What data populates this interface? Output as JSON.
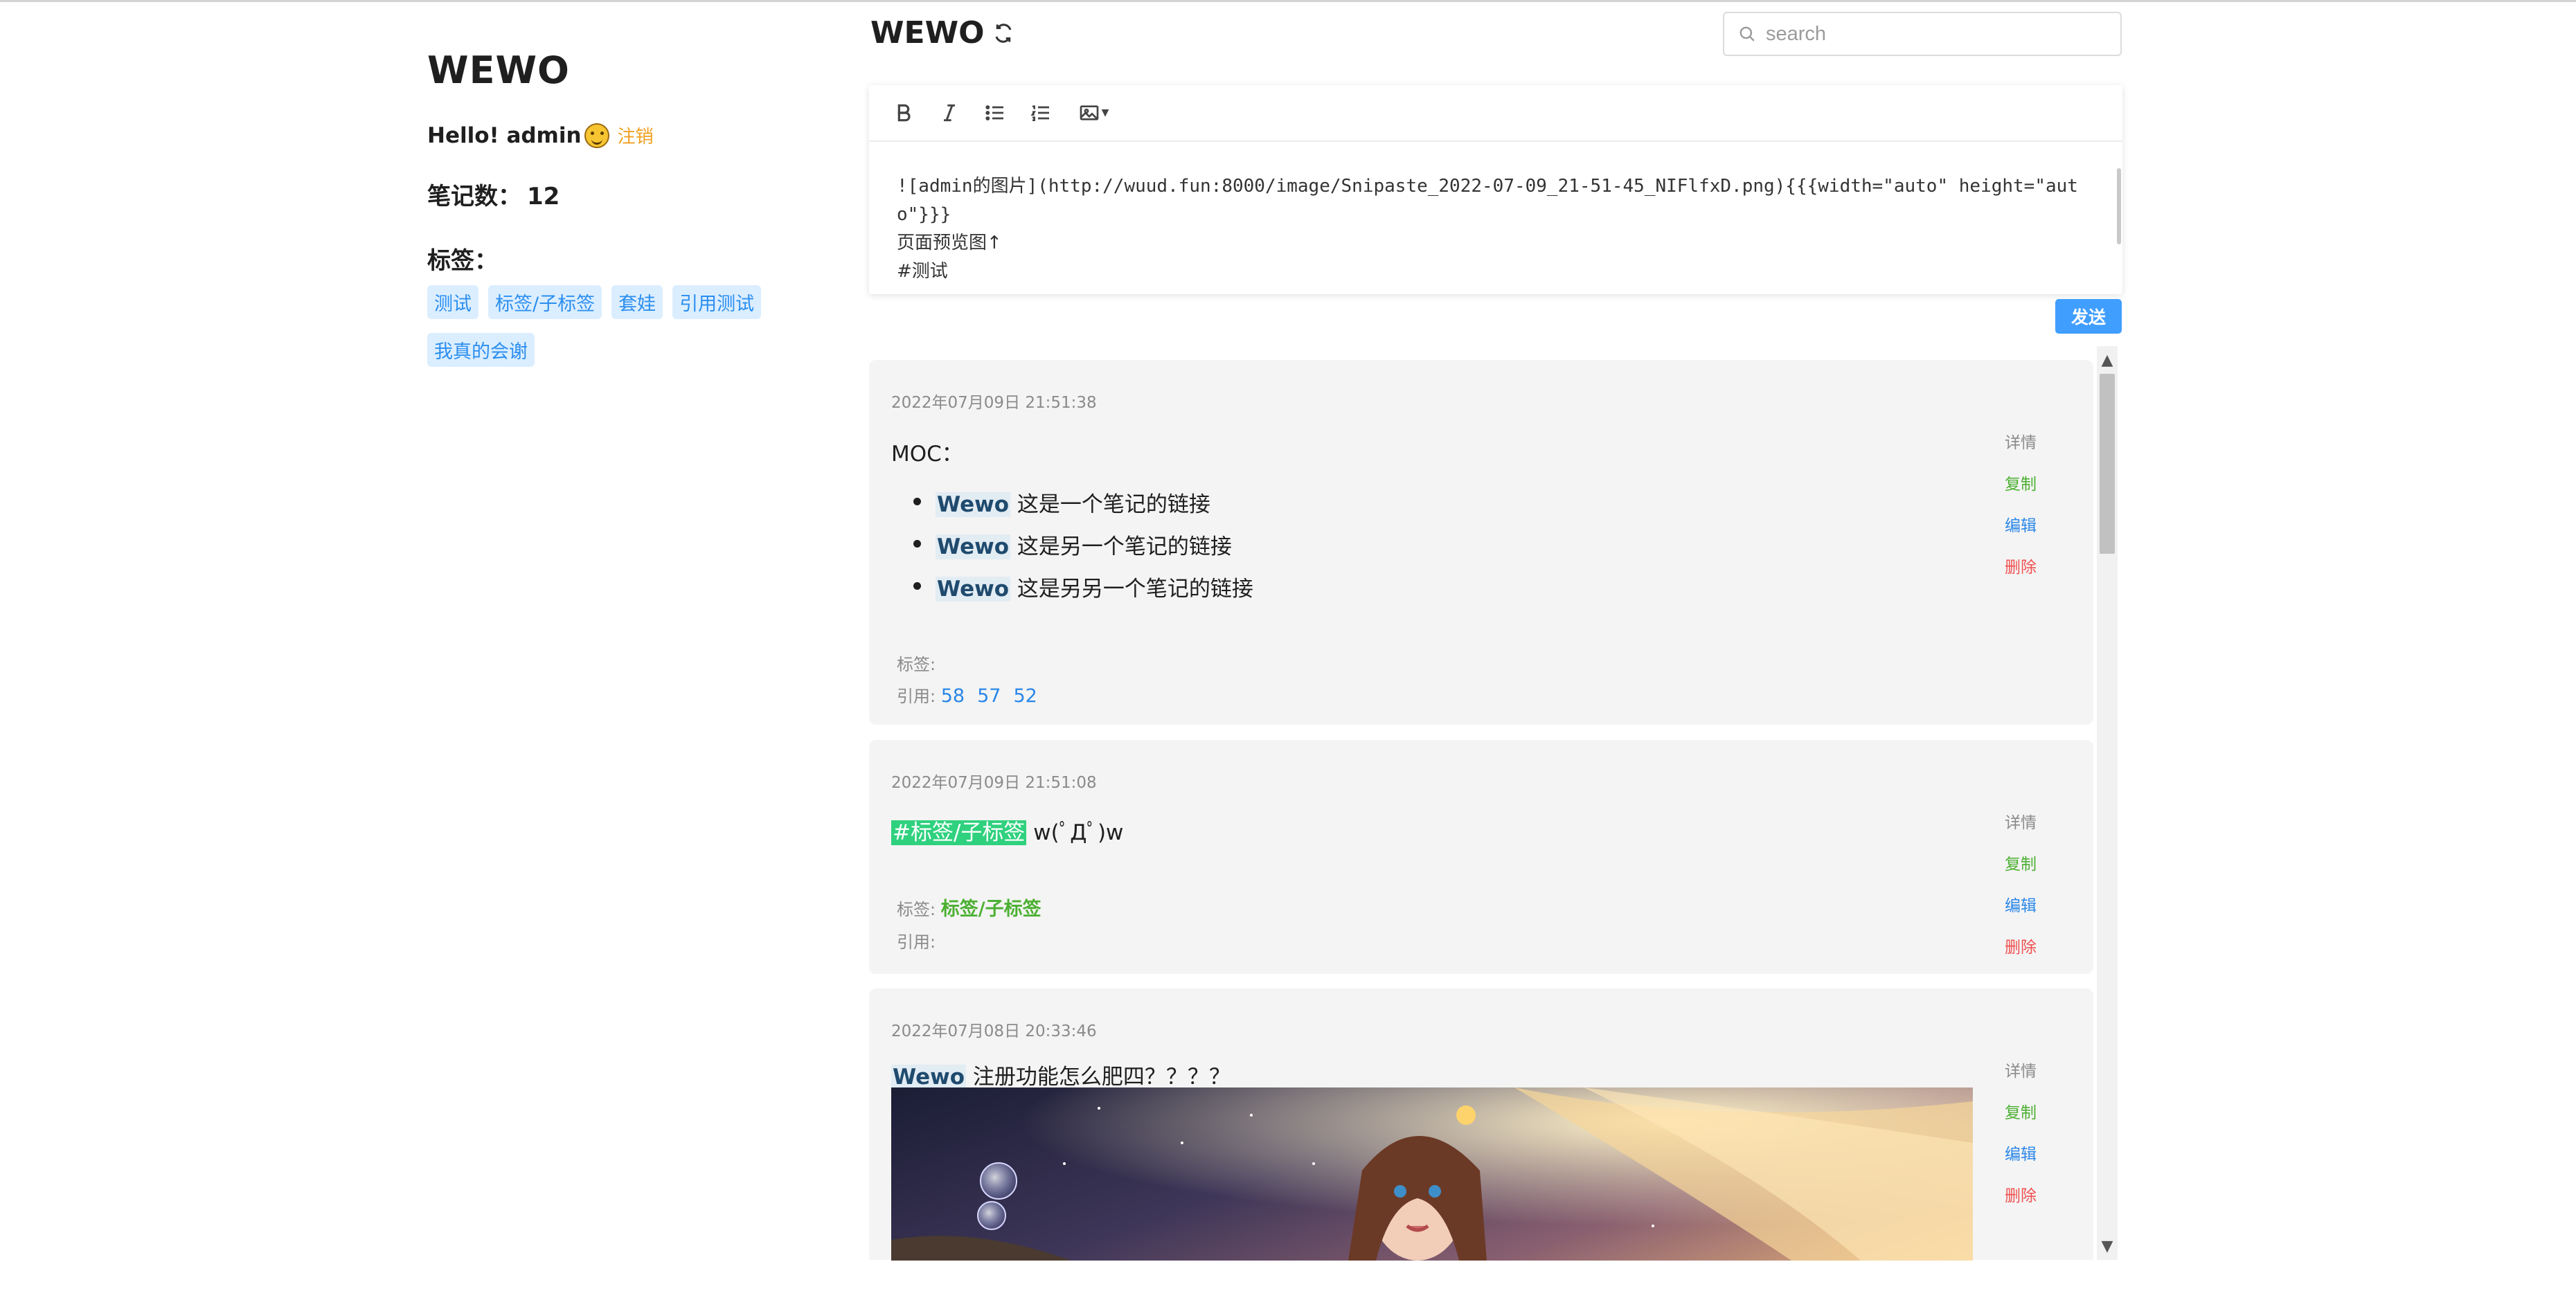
{
  "sidebar": {
    "brand": "WEWO",
    "greeting": "Hello! admin",
    "logout_label": "注销",
    "note_count_label": "笔记数：",
    "note_count": "12",
    "tags_title": "标签：",
    "tags": [
      "测试",
      "标签/子标签",
      "套娃",
      "引用测试",
      "我真的会谢"
    ]
  },
  "header": {
    "title": "WEWO",
    "refresh_icon": "refresh-icon"
  },
  "search": {
    "placeholder": "search",
    "value": ""
  },
  "editor": {
    "toolbar": [
      "bold-icon",
      "italic-icon",
      "bullet-list-icon",
      "ordered-list-icon",
      "image-icon"
    ],
    "line1": "![admin的图片](http://wuud.fun:8000/image/Snipaste_2022-07-09_21-51-45_NIFlfxD.png){{{width=\"auto\" height=\"auto\"}}}",
    "line2": "页面预览图↑",
    "line3": "#测试",
    "send_label": "发送"
  },
  "actions": {
    "detail": "详情",
    "copy": "复制",
    "edit": "编辑",
    "delete": "删除"
  },
  "meta_labels": {
    "tags": "标签:",
    "refs": "引用:"
  },
  "notes": [
    {
      "time": "2022年07月09日 21:51:38",
      "heading": "MOC：",
      "links": [
        {
          "tag": "Wewo",
          "text": " 这是一个笔记的链接"
        },
        {
          "tag": "Wewo",
          "text": " 这是另一个笔记的链接"
        },
        {
          "tag": "Wewo",
          "text": " 这是另另一个笔记的链接"
        }
      ],
      "tags": "",
      "refs": [
        "58",
        "57",
        "52"
      ]
    },
    {
      "time": "2022年07月09日 21:51:08",
      "hashtag": "#标签/子标签",
      "text": " w(ﾟДﾟ)w",
      "tags": "标签/子标签",
      "refs": []
    },
    {
      "time": "2022年07月08日 20:33:46",
      "tag": "Wewo",
      "text": " 注册功能怎么肥四？？？？"
    }
  ],
  "colors": {
    "accent": "#409eff",
    "tag_bg": "#dbeeff",
    "copy": "#4cb032",
    "edit": "#2a87e8",
    "delete": "#f05050",
    "logout": "#f0a020",
    "hashtag_bg": "#2fd17e"
  }
}
